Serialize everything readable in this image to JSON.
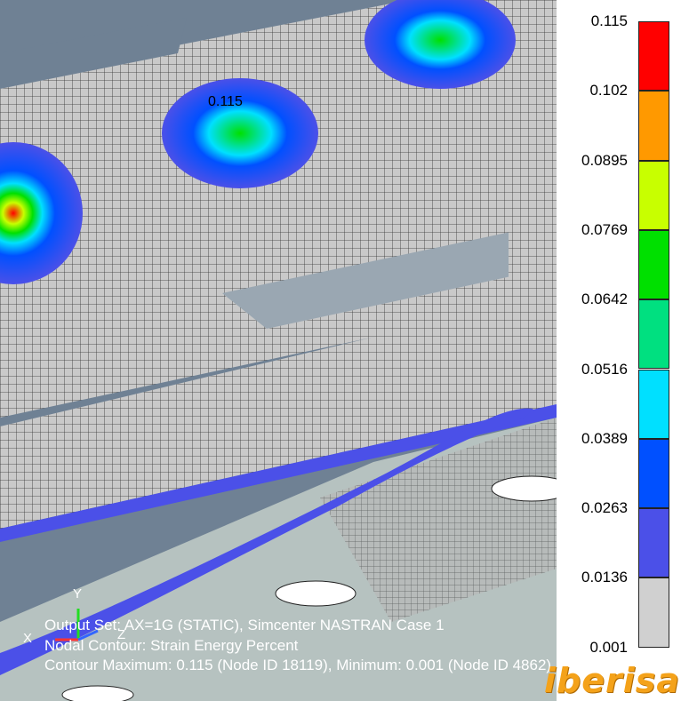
{
  "legend": {
    "labels": [
      "0.115",
      "0.102",
      "0.0895",
      "0.0769",
      "0.0642",
      "0.0516",
      "0.0389",
      "0.0263",
      "0.0136",
      "0.001"
    ],
    "colors": [
      "#ff0000",
      "#ff9900",
      "#c8ff00",
      "#00e000",
      "#00e080",
      "#00e0ff",
      "#0050ff",
      "#4b50e8",
      "#d0d0d0"
    ]
  },
  "viewport": {
    "peak_label": "0.115",
    "axis_x": "X",
    "axis_y": "Y",
    "axis_z": "Z"
  },
  "info": {
    "output_set": "Output Set: AX=1G (STATIC), Simcenter NASTRAN Case 1",
    "contour": "Nodal Contour: Strain Energy Percent",
    "minmax": "Contour Maximum: 0.115 (Node ID 18119), Minimum: 0.001 (Node ID 4862)"
  },
  "brand": "iberisa"
}
